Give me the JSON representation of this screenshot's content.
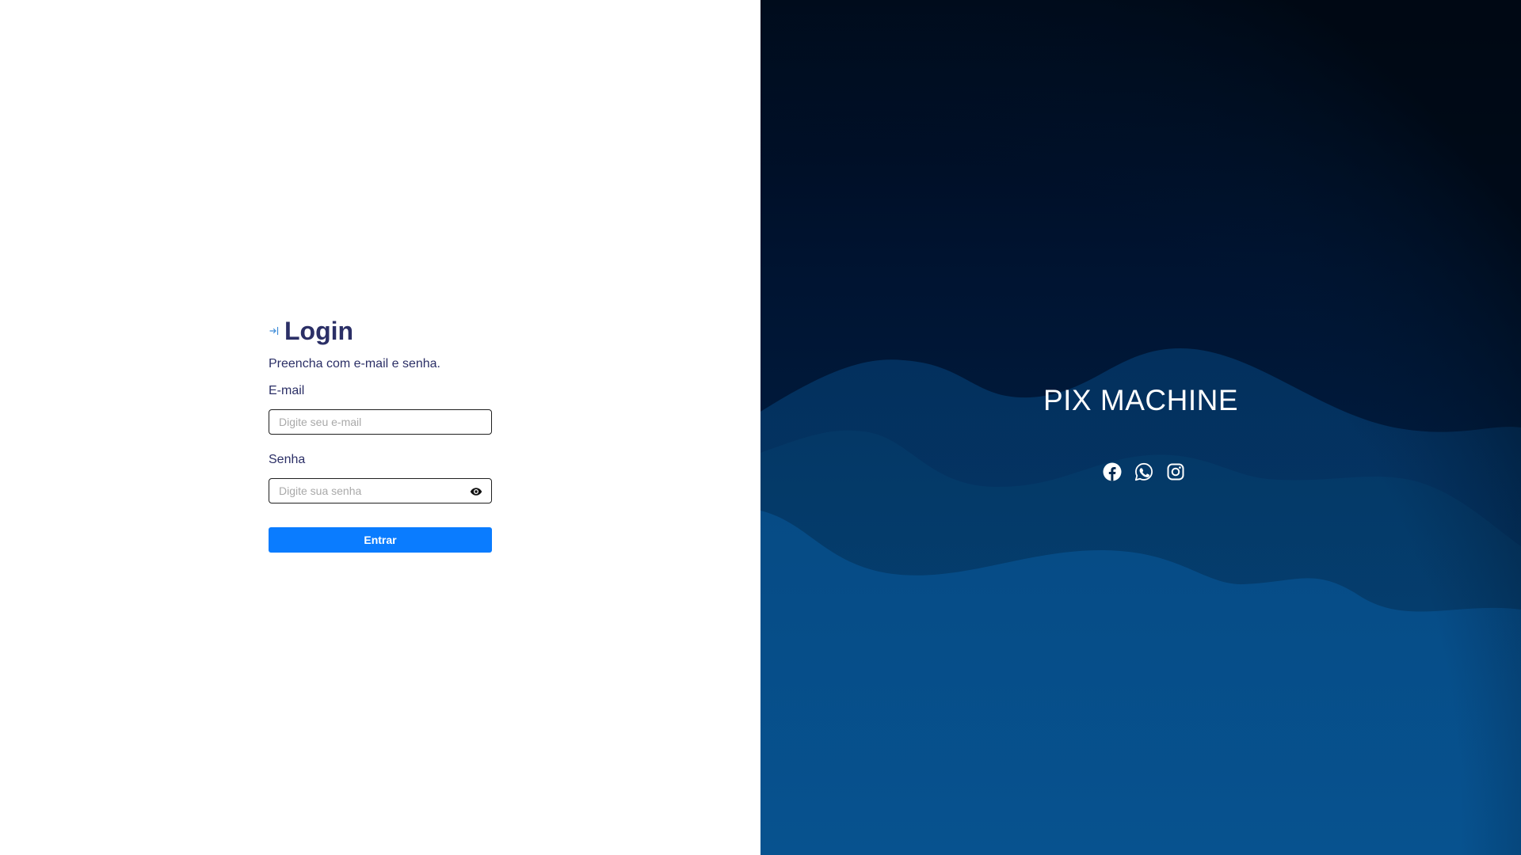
{
  "login": {
    "title": "Login",
    "subtitle": "Preencha com e-mail e senha.",
    "email_label": "E-mail",
    "email_placeholder": "Digite seu e-mail",
    "password_label": "Senha",
    "password_placeholder": "Digite sua senha",
    "submit_label": "Entrar",
    "title_icon": "login-arrow-icon"
  },
  "brand": {
    "name": "PIX MACHINE",
    "social": [
      "facebook-icon",
      "whatsapp-icon",
      "instagram-icon"
    ]
  },
  "colors": {
    "heading": "#2b2f66",
    "primary": "#0a7cff",
    "panel_dark": "#000918",
    "panel_blue": "#0a4d87"
  }
}
